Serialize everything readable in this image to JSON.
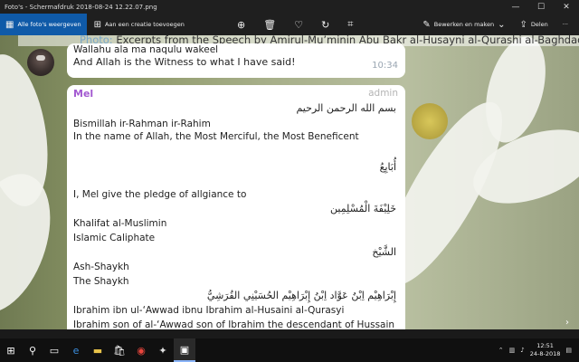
{
  "window": {
    "title": "Foto's - Schermafdruk 2018-08-24 12.22.07.png",
    "minimize": "—",
    "maximize": "☐",
    "close": "✕"
  },
  "toolbar": {
    "all_photos": "Alle foto's weergeven",
    "add_creation": "Aan een creatie toevoegen",
    "edit_create": "Bewerken en maken",
    "share": "Delen",
    "more": "···"
  },
  "photo": {
    "header_label": "Photo:",
    "header_text": " Excerpts from the Speech by Amirul-Mu’minin Abu Bakr al-Husayni al-Qurashi al-Baghdadi (m",
    "bubble1_line1": "Wallahu ala ma naqulu wakeel",
    "bubble1_line2": "And Allah is the Witness to what I have said!",
    "bubble1_time": "10:34",
    "sender": "Mel",
    "role": "admin",
    "arabic_basmala": "بسم الله الرحمن الرحيم",
    "basmala_translit": "Bismillah ir-Rahman ir-Rahim",
    "basmala_translation": "In the name of Allah, the Most Merciful, the Most Beneficent",
    "arabic_pledge": "أُبَايِعُ",
    "pledge_text": "I, Mel give the pledge of allgiance to",
    "arabic_khalifat": "خَلِيْفَةَ الْمُسْلِمِين",
    "khalifat_translit": "Khalifat al-Muslimin",
    "khalifat_translation": "Islamic Caliphate",
    "arabic_shaykh": "الشَّيْخ",
    "shaykh_translit": "Ash-Shaykh",
    "shaykh_translation": "The Shaykh",
    "arabic_name": "إِبْرَاهِيْم اِبْنُ عَوَّاد اِبْنُ إِبْرَاهِيْم الحُسَيْنِي القُرَشِيُّ",
    "name_translit": "Ibrahim ibn ul-‘Awwad ibnu Ibrahim al-Husaini al-Qurasyi",
    "name_translation": "Ibrahim son of al-‘Awwad son of Ibrahim the descendant of Hussain"
  },
  "taskbar": {
    "time": "12:51",
    "date": "24-8-2018"
  }
}
